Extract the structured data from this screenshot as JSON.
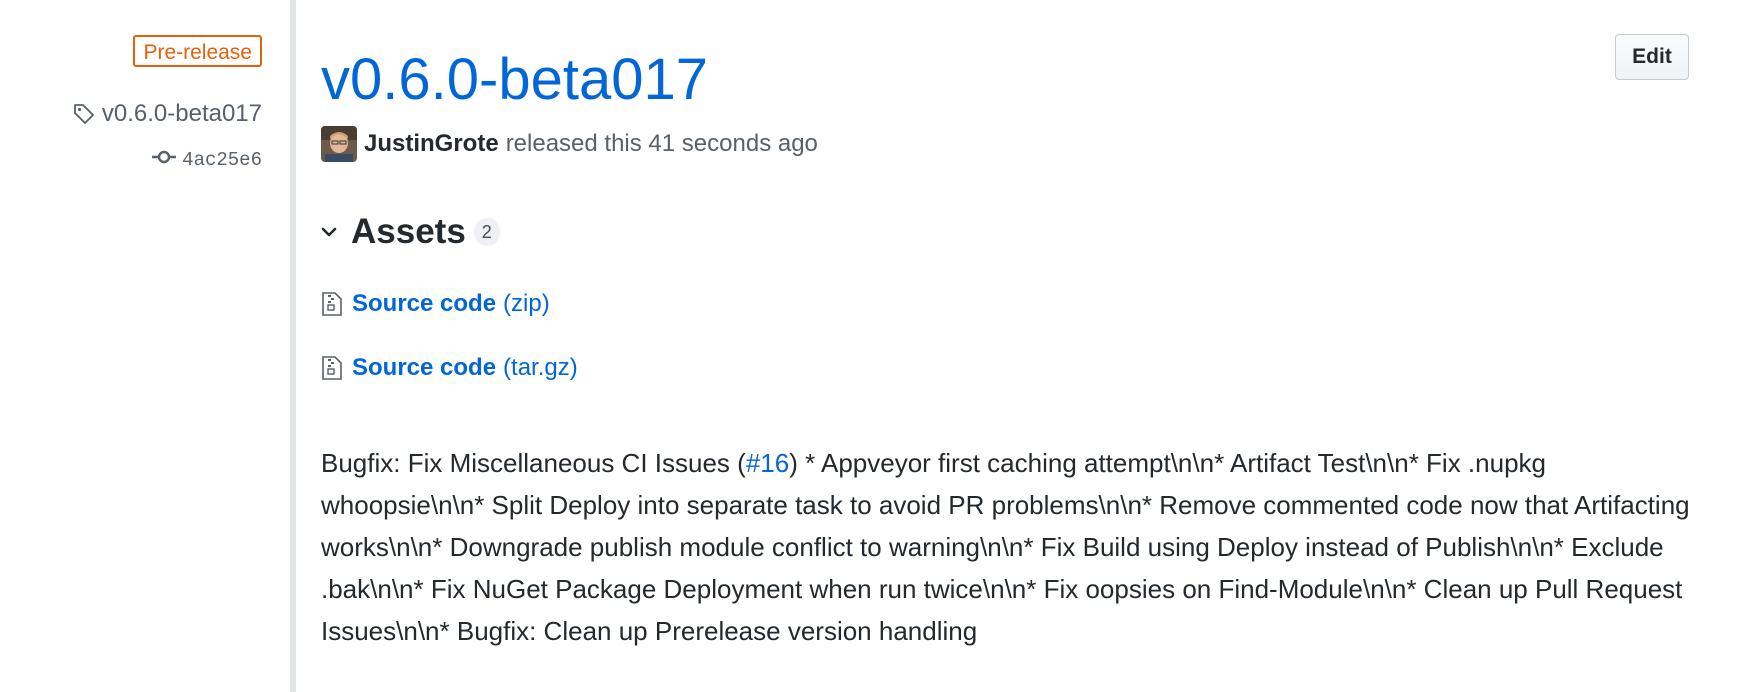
{
  "sidebar": {
    "badge": "Pre-release",
    "tag": "v0.6.0-beta017",
    "commit": "4ac25e6"
  },
  "release": {
    "title": "v0.6.0-beta017",
    "edit_label": "Edit",
    "author": "JustinGrote",
    "released_text": "released this 41 seconds ago"
  },
  "assets": {
    "title": "Assets",
    "count": "2",
    "items": [
      {
        "name": "Source code",
        "format": "(zip)"
      },
      {
        "name": "Source code",
        "format": "(tar.gz)"
      }
    ]
  },
  "notes": {
    "before_link": "Bugfix: Fix Miscellaneous CI Issues (",
    "link_text": "#16",
    "after_link": ") * Appveyor first caching attempt\\n\\n* Artifact Test\\n\\n* Fix .nupkg whoopsie\\n\\n* Split Deploy into separate task to avoid PR problems\\n\\n* Remove commented code now that Artifacting works\\n\\n* Downgrade publish module conflict to warning\\n\\n* Fix Build using Deploy instead of Publish\\n\\n* Exclude .bak\\n\\n* Fix NuGet Package Deployment when run twice\\n\\n* Fix oopsies on Find-Module\\n\\n* Clean up Pull Request Issues\\n\\n* Bugfix: Clean up Prerelease version handling"
  },
  "colors": {
    "link": "#0366d6",
    "prerelease": "#e36209",
    "text": "#24292e",
    "muted": "#586069"
  },
  "icons": {
    "tag": "tag-icon",
    "commit": "git-commit-icon",
    "chevron": "chevron-down-icon",
    "file_zip": "file-zip-icon"
  }
}
